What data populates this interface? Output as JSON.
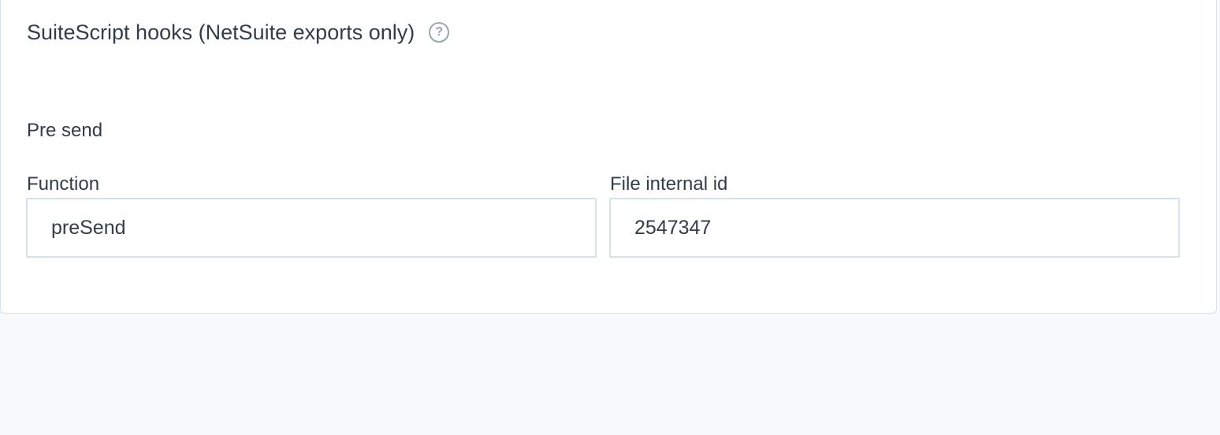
{
  "section": {
    "title": "SuiteScript hooks (NetSuite exports only)",
    "help_icon": "question-circle-icon",
    "help_glyph": "?"
  },
  "pre_send": {
    "label": "Pre send",
    "function": {
      "label": "Function",
      "value": "preSend"
    },
    "file_internal_id": {
      "label": "File internal id",
      "value": "2547347"
    }
  },
  "colors": {
    "text": "#333d47",
    "border": "#d6e1ea",
    "background": "#f7f9fd",
    "panel": "#ffffff",
    "icon": "#9aa6b0"
  }
}
